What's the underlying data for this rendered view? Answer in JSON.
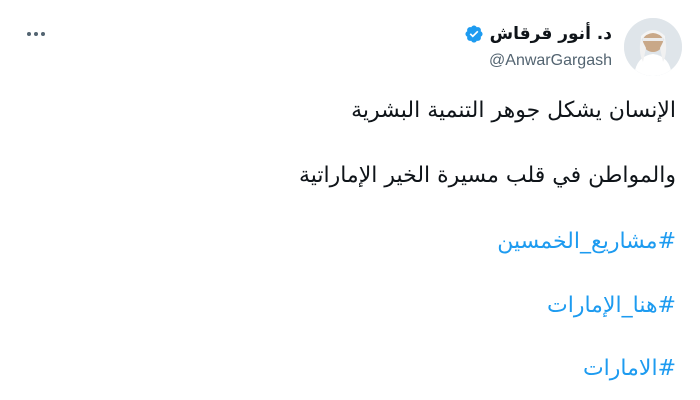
{
  "author": {
    "display_name": "د. أنور قرقاش",
    "handle": "@AnwarGargash",
    "verified": true
  },
  "tweet": {
    "lines": [
      "الإنسان يشكل جوهر التنمية البشرية",
      "والمواطن في قلب مسيرة الخير الإماراتية"
    ],
    "hashtags": [
      "#مشاريع_الخمسين",
      "#هنا_الإمارات",
      "#الامارات"
    ]
  },
  "icons": {
    "more": "more-horizontal-icon",
    "verified": "verified-badge-icon"
  },
  "colors": {
    "accent": "#1d9bf0",
    "text": "#0f1419",
    "secondary": "#536471"
  }
}
